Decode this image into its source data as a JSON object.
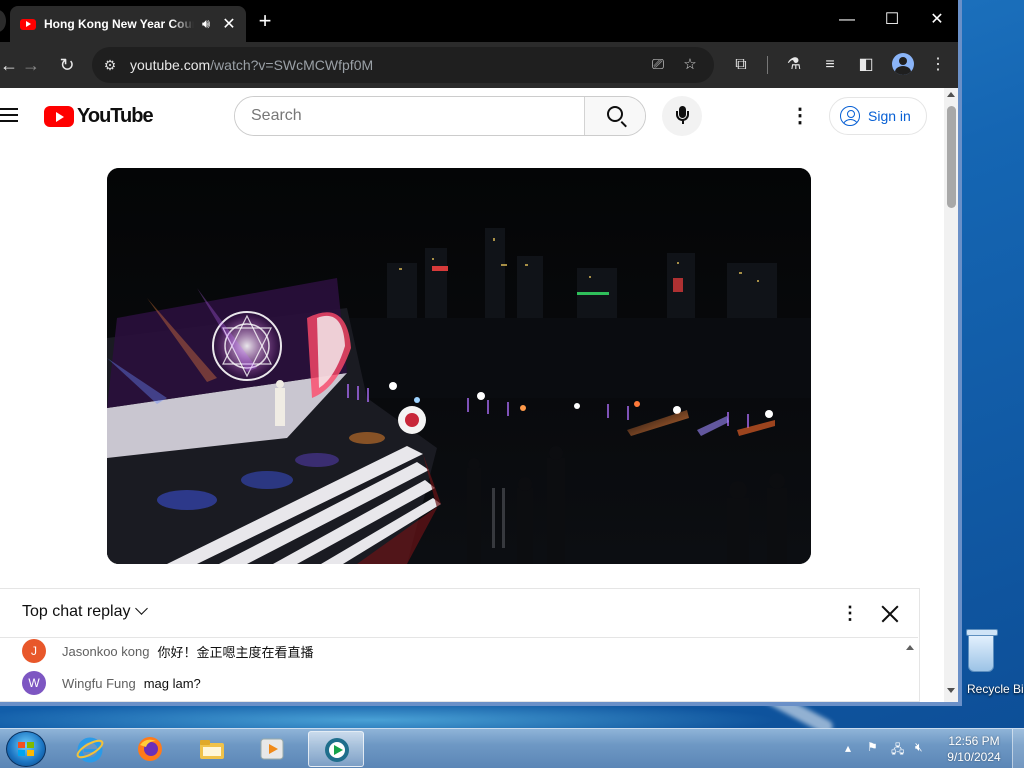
{
  "browser": {
    "tab_title": "Hong Kong New Year Countdown",
    "new_tab_symbol": "+",
    "url_host": "youtube.com",
    "url_path": "/watch?v=SWcMCWfpf0M",
    "window_controls": {
      "minimize": "—",
      "maximize": "☐",
      "close": "✕"
    }
  },
  "youtube": {
    "logo_text": "YouTube",
    "search_placeholder": "Search",
    "signin_label": "Sign in"
  },
  "chat": {
    "mode_label": "Top chat replay",
    "messages": [
      {
        "initial": "J",
        "author": "Jasonkoo kong",
        "text": "你好！金正嗯主度在看直播",
        "color": "#e8572a"
      },
      {
        "initial": "W",
        "author": "Wingfu Fung",
        "text": "mag lam?",
        "color": "#7d56c2"
      }
    ]
  },
  "desktop": {
    "recycle_bin_label": "Recycle Bin"
  },
  "taskbar": {
    "clock_time": "12:56 PM",
    "clock_date": "9/10/2024",
    "apps": [
      "internet-explorer",
      "firefox",
      "file-explorer",
      "media-player",
      "chrome-remote"
    ]
  },
  "colors": {
    "youtube_red": "#ff0000",
    "link_blue": "#065fd4",
    "chrome_dark": "#2b2b2b"
  }
}
